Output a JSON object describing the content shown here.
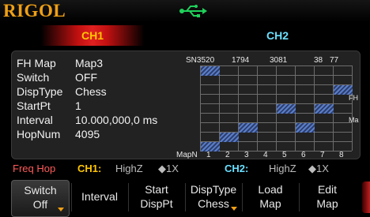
{
  "brand": "RIGOL",
  "usb_icon": "usb-icon",
  "tabs": {
    "ch1": "CH1",
    "ch2": "CH2"
  },
  "params": {
    "fh_map": {
      "label": "FH Map",
      "value": "Map3"
    },
    "switch": {
      "label": "Switch",
      "value": "OFF"
    },
    "disp_type": {
      "label": "DispType",
      "value": "Chess"
    },
    "start_pt": {
      "label": "StartPt",
      "value": "1"
    },
    "interval": {
      "label": "Interval",
      "value": "10.000,000,0 ms"
    },
    "hop_num": {
      "label": "HopNum",
      "value": "4095"
    }
  },
  "grid": {
    "sn_label": "SN3520",
    "sn_values": [
      "1794",
      "3081",
      "38",
      "77"
    ],
    "map_label": "MapN",
    "columns": [
      "1",
      "2",
      "3",
      "4",
      "5",
      "6",
      "7",
      "8"
    ],
    "side_labels": [
      "FH",
      "Ma"
    ],
    "highlight_colors": {
      "hatch_light": "#5a7ec8",
      "hatch_dark": "#2d3f6e"
    }
  },
  "status": {
    "mode": "Freq Hop",
    "ch1_label": "CH1:",
    "ch1_impedance": "HighZ",
    "ch1_amp": "◆1X",
    "ch2_label": "CH2:",
    "ch2_impedance": "HighZ",
    "ch2_amp": "◆1X"
  },
  "softkeys": {
    "switch": {
      "line1": "Switch",
      "line2": "Off"
    },
    "interval": {
      "label": "Interval"
    },
    "start_disp": {
      "line1": "Start",
      "line2": "DispPt"
    },
    "disp_type": {
      "line1": "DispType",
      "line2": "Chess"
    },
    "load_map": {
      "line1": "Load",
      "line2": "Map"
    },
    "edit_map": {
      "line1": "Edit",
      "line2": "Map"
    }
  },
  "colors": {
    "brand": "#f0a015",
    "ch1": "#ffc600",
    "ch2": "#6ae0ff",
    "mode": "#ff5a5a"
  }
}
